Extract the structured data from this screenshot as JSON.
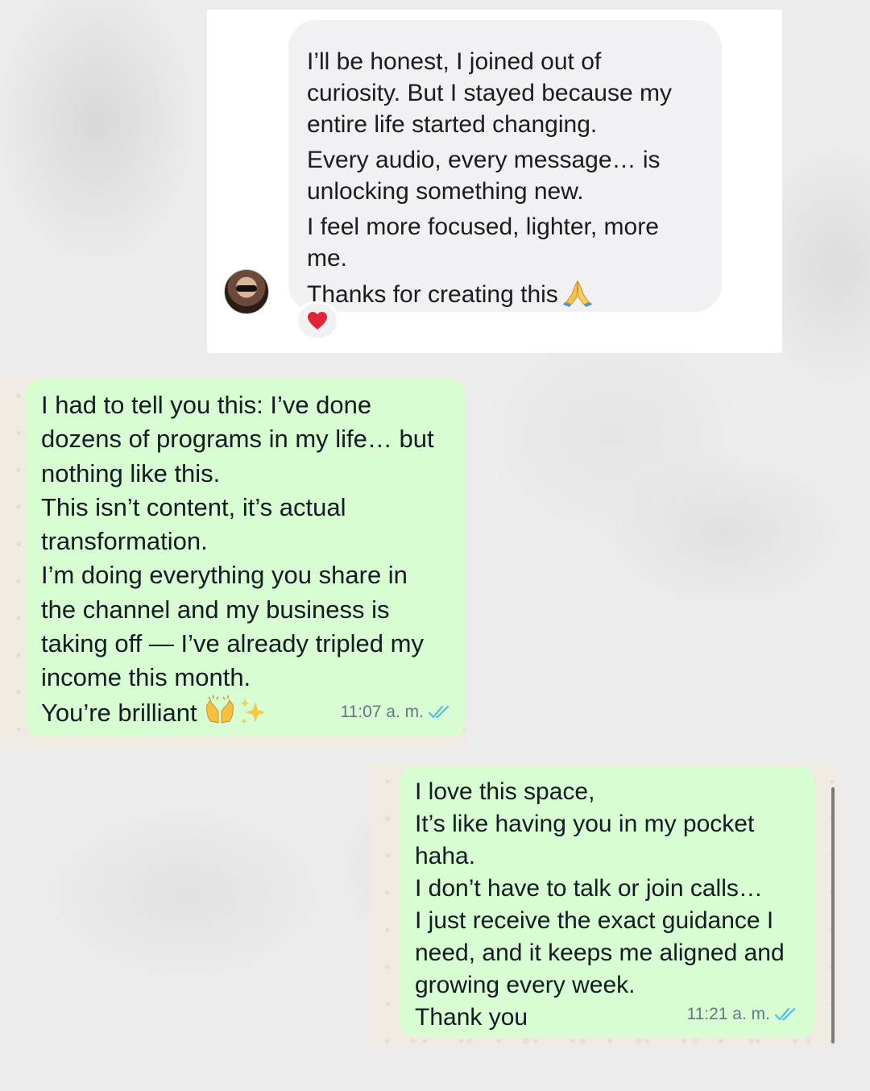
{
  "card1": {
    "paragraphs": [
      [
        "I’ll be honest, I joined out of",
        "curiosity. But I stayed because my",
        "entire life started changing."
      ],
      [
        "Every audio, every message… is",
        "unlocking something new."
      ],
      [
        "I feel more focused, lighter, more",
        "me."
      ]
    ],
    "last_line": "Thanks for creating this",
    "last_line_emoji": "pray-icon",
    "reaction": "heart-icon",
    "avatar": "avatar",
    "colors": {
      "bubble": "#f1f1f3",
      "heart": "#e0243a"
    }
  },
  "card2": {
    "lines": [
      "I had to tell you this: I’ve done",
      "dozens of programs in my life… but",
      "nothing like this.",
      "This isn’t content, it’s actual",
      "transformation.",
      "I’m doing everything you share in",
      "the channel and my business is",
      "taking off — I’ve already tripled my",
      "income this month."
    ],
    "last_line": "You’re brilliant",
    "last_line_emojis": [
      "raising-hands-icon",
      "sparkles-icon"
    ],
    "time": "11:07 a. m.",
    "status_icon": "double-check-icon",
    "colors": {
      "bubble": "#d9fdd3",
      "check": "#53bdeb"
    }
  },
  "card3": {
    "lines": [
      "I love this space,",
      "It’s like having you in my pocket",
      "haha.",
      "I don’t have to talk or join calls…",
      "I just receive the exact guidance I",
      "need, and it keeps me aligned and",
      "growing every week.",
      "Thank you"
    ],
    "time": "11:21 a. m.",
    "status_icon": "double-check-icon"
  }
}
